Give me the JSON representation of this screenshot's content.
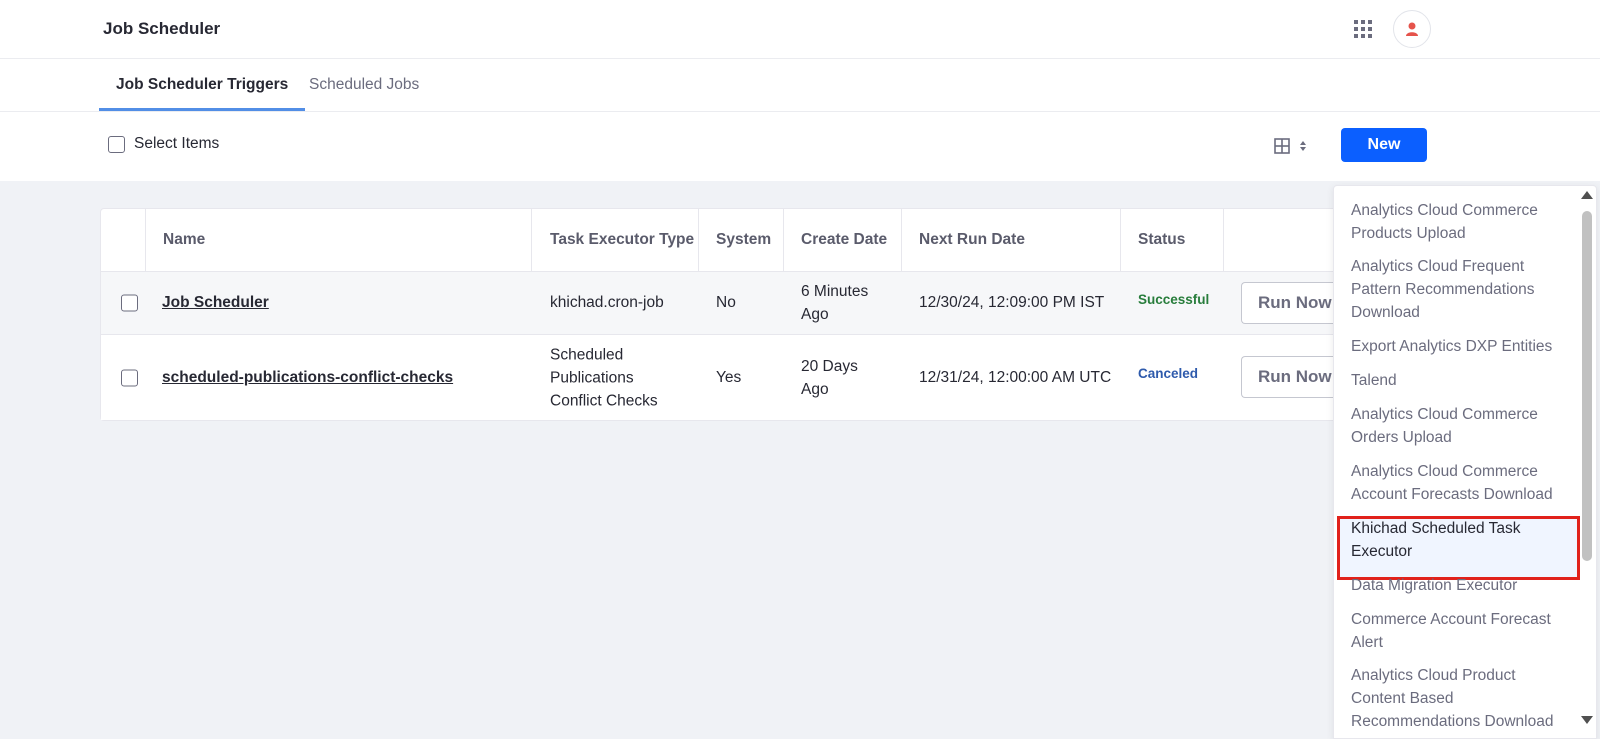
{
  "header": {
    "title": "Job Scheduler",
    "apps_icon": "apps-grid-icon",
    "avatar_icon": "user-icon"
  },
  "tabs": [
    {
      "label": "Job Scheduler Triggers",
      "active": true
    },
    {
      "label": "Scheduled Jobs",
      "active": false
    }
  ],
  "toolbar": {
    "select_items_label": "Select Items",
    "view_icon": "table-view-icon",
    "new_label": "New"
  },
  "table": {
    "columns": [
      "Name",
      "Task Executor Type",
      "System",
      "Create Date",
      "Next Run Date",
      "Status"
    ],
    "rows": [
      {
        "name": "Job Scheduler",
        "executor_type": "khichad.cron-job",
        "system": "No",
        "create_date_1": "6 Minutes",
        "create_date_2": "Ago",
        "next_run_date": "12/30/24, 12:09:00 PM IST",
        "status": "Successful",
        "action": "Run Now"
      },
      {
        "name": "scheduled-publications-conflict-checks",
        "executor_type_1": "Scheduled",
        "executor_type_2": "Publications",
        "executor_type_3": "Conflict Checks",
        "system": "Yes",
        "create_date_1": "20 Days",
        "create_date_2": "Ago",
        "next_run_date": "12/31/24, 12:00:00 AM UTC",
        "status": "Canceled",
        "action": "Run Now"
      }
    ]
  },
  "colors": {
    "primary": "#0b5fff",
    "tab_indicator": "#528ee6",
    "success": "#287d3c",
    "canceled": "#2e5aac",
    "highlight_border": "#e1211b"
  },
  "dropdown": {
    "items": [
      {
        "line1": "Analytics Cloud Commerce",
        "line2": "Products Upload"
      },
      {
        "line1": "Analytics Cloud Frequent",
        "line2": "Pattern Recommendations",
        "line3": "Download"
      },
      {
        "line1": "Export Analytics DXP Entities"
      },
      {
        "line1": "Talend"
      },
      {
        "line1": "Analytics Cloud Commerce",
        "line2": "Orders Upload"
      },
      {
        "line1": "Analytics Cloud Commerce",
        "line2": "Account Forecasts Download"
      },
      {
        "line1": "Khichad Scheduled Task",
        "line2": "Executor",
        "highlighted": true
      },
      {
        "line1": "Data Migration Executor"
      },
      {
        "line1": "Commerce Account Forecast",
        "line2": "Alert"
      },
      {
        "line1": "Analytics Cloud Product",
        "line2": "Content Based",
        "line3": "Recommendations Download"
      }
    ]
  }
}
